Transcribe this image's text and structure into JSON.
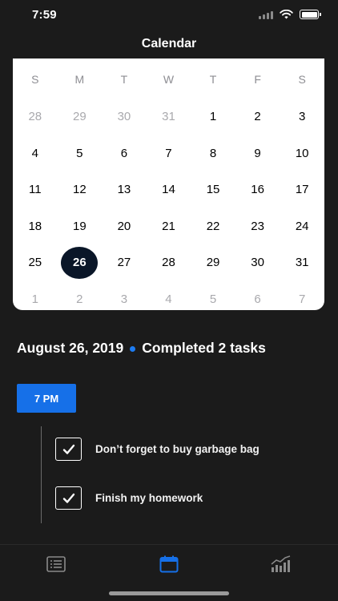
{
  "status_bar": {
    "time": "7:59",
    "icons": [
      "signal-icon",
      "wifi-icon",
      "battery-icon"
    ]
  },
  "nav": {
    "title": "Calendar"
  },
  "calendar": {
    "weekdays": [
      "S",
      "M",
      "T",
      "W",
      "T",
      "F",
      "S"
    ],
    "weeks": [
      [
        {
          "d": "28",
          "m": true
        },
        {
          "d": "29",
          "m": true
        },
        {
          "d": "30",
          "m": true
        },
        {
          "d": "31",
          "m": true
        },
        {
          "d": "1"
        },
        {
          "d": "2"
        },
        {
          "d": "3"
        }
      ],
      [
        {
          "d": "4"
        },
        {
          "d": "5"
        },
        {
          "d": "6"
        },
        {
          "d": "7"
        },
        {
          "d": "8"
        },
        {
          "d": "9"
        },
        {
          "d": "10"
        }
      ],
      [
        {
          "d": "11"
        },
        {
          "d": "12"
        },
        {
          "d": "13"
        },
        {
          "d": "14"
        },
        {
          "d": "15"
        },
        {
          "d": "16"
        },
        {
          "d": "17"
        }
      ],
      [
        {
          "d": "18"
        },
        {
          "d": "19"
        },
        {
          "d": "20"
        },
        {
          "d": "21"
        },
        {
          "d": "22"
        },
        {
          "d": "23"
        },
        {
          "d": "24"
        }
      ],
      [
        {
          "d": "25"
        },
        {
          "d": "26",
          "sel": true
        },
        {
          "d": "27"
        },
        {
          "d": "28"
        },
        {
          "d": "29"
        },
        {
          "d": "30"
        },
        {
          "d": "31"
        }
      ],
      [
        {
          "d": "1",
          "m": true
        },
        {
          "d": "2",
          "m": true
        },
        {
          "d": "3",
          "m": true
        },
        {
          "d": "4",
          "m": true
        },
        {
          "d": "5",
          "m": true
        },
        {
          "d": "6",
          "m": true
        },
        {
          "d": "7",
          "m": true
        }
      ]
    ],
    "selected_color": "#0a1628"
  },
  "summary": {
    "date": "August 26, 2019",
    "status": "Completed 2 tasks",
    "dot_color": "#1d7cf2"
  },
  "schedule": {
    "time_label": "7 PM",
    "accent": "#1670e8",
    "tasks": [
      {
        "label": "Don’t forget to buy garbage bag",
        "checked": true
      },
      {
        "label": "Finish my homework",
        "checked": true
      }
    ]
  },
  "tab_bar": {
    "tabs": [
      {
        "icon": "list-icon",
        "active": false
      },
      {
        "icon": "calendar-icon",
        "active": true
      },
      {
        "icon": "stats-chart-icon",
        "active": false
      }
    ],
    "active_color": "#1670e8",
    "inactive_color": "#8a8a8a"
  }
}
